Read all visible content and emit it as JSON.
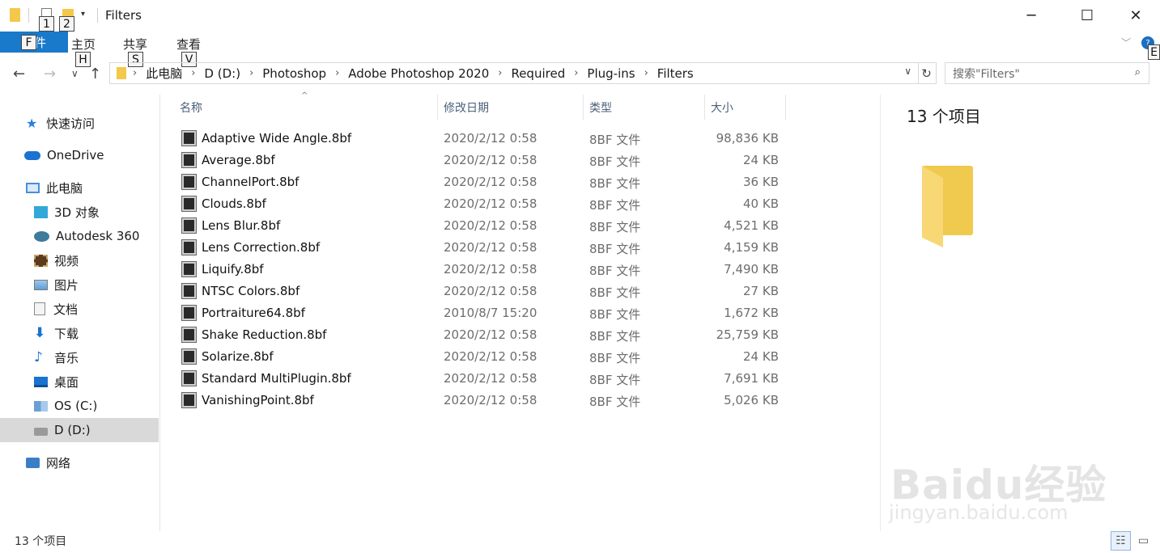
{
  "window": {
    "title": "Filters",
    "minimize": "─",
    "maximize": "☐",
    "close": "✕"
  },
  "keytips": {
    "qa1": "1",
    "qa2": "2",
    "file": "F",
    "home": "H",
    "share": "S",
    "view": "V",
    "help": "E"
  },
  "ribbon": {
    "file_label": "文件",
    "tabs": [
      "主页",
      "共享",
      "查看"
    ],
    "collapse": "﹀",
    "help": "?"
  },
  "nav_buttons": {
    "back": "←",
    "forward": "→",
    "recent": "∨",
    "up": "↑"
  },
  "address": {
    "crumbs": [
      "此电脑",
      "D (D:)",
      "Photoshop",
      "Adobe Photoshop 2020",
      "Required",
      "Plug-ins",
      "Filters"
    ],
    "separator": "›",
    "dropdown": "∨",
    "refresh": "↻"
  },
  "search": {
    "placeholder": "搜索\"Filters\"",
    "icon": "⌕"
  },
  "sidebar": {
    "items": [
      {
        "label": "快速访问",
        "icon": "star-icon",
        "color": "#2b7de1"
      },
      {
        "label": "OneDrive",
        "icon": "cloud-icon",
        "color": "#1a73d1"
      },
      {
        "label": "此电脑",
        "icon": "computer-icon",
        "color": "#4a8fd6"
      },
      {
        "label": "3D 对象",
        "icon": "cube-icon",
        "color": "#31a8d8"
      },
      {
        "label": "Autodesk 360",
        "icon": "autodesk-icon",
        "color": "#3c7b9c"
      },
      {
        "label": "视频",
        "icon": "film-icon",
        "color": "#5a3c1c"
      },
      {
        "label": "图片",
        "icon": "picture-icon",
        "color": "#4a8fd6"
      },
      {
        "label": "文档",
        "icon": "document-icon",
        "color": "#8a8a8a"
      },
      {
        "label": "下载",
        "icon": "download-icon",
        "color": "#1a73d1"
      },
      {
        "label": "音乐",
        "icon": "music-icon",
        "color": "#1a73d1"
      },
      {
        "label": "桌面",
        "icon": "desktop-icon",
        "color": "#1a73d1"
      },
      {
        "label": "OS (C:)",
        "icon": "windows-drive-icon",
        "color": "#6a9fd6"
      },
      {
        "label": "D (D:)",
        "icon": "drive-icon",
        "color": "#888888"
      },
      {
        "label": "网络",
        "icon": "network-icon",
        "color": "#3a7fc6"
      }
    ]
  },
  "columns": {
    "name": "名称",
    "date": "修改日期",
    "type": "类型",
    "size": "大小",
    "sort": "^"
  },
  "files": [
    {
      "name": "Adaptive Wide Angle.8bf",
      "date": "2020/2/12 0:58",
      "type": "8BF 文件",
      "size": "98,836 KB"
    },
    {
      "name": "Average.8bf",
      "date": "2020/2/12 0:58",
      "type": "8BF 文件",
      "size": "24 KB"
    },
    {
      "name": "ChannelPort.8bf",
      "date": "2020/2/12 0:58",
      "type": "8BF 文件",
      "size": "36 KB"
    },
    {
      "name": "Clouds.8bf",
      "date": "2020/2/12 0:58",
      "type": "8BF 文件",
      "size": "40 KB"
    },
    {
      "name": "Lens Blur.8bf",
      "date": "2020/2/12 0:58",
      "type": "8BF 文件",
      "size": "4,521 KB"
    },
    {
      "name": "Lens Correction.8bf",
      "date": "2020/2/12 0:58",
      "type": "8BF 文件",
      "size": "4,159 KB"
    },
    {
      "name": "Liquify.8bf",
      "date": "2020/2/12 0:58",
      "type": "8BF 文件",
      "size": "7,490 KB"
    },
    {
      "name": "NTSC Colors.8bf",
      "date": "2020/2/12 0:58",
      "type": "8BF 文件",
      "size": "27 KB"
    },
    {
      "name": "Portraiture64.8bf",
      "date": "2010/8/7 15:20",
      "type": "8BF 文件",
      "size": "1,672 KB"
    },
    {
      "name": "Shake Reduction.8bf",
      "date": "2020/2/12 0:58",
      "type": "8BF 文件",
      "size": "25,759 KB"
    },
    {
      "name": "Solarize.8bf",
      "date": "2020/2/12 0:58",
      "type": "8BF 文件",
      "size": "24 KB"
    },
    {
      "name": "Standard MultiPlugin.8bf",
      "date": "2020/2/12 0:58",
      "type": "8BF 文件",
      "size": "7,691 KB"
    },
    {
      "name": "VanishingPoint.8bf",
      "date": "2020/2/12 0:58",
      "type": "8BF 文件",
      "size": "5,026 KB"
    }
  ],
  "preview": {
    "count_label": "13 个项目"
  },
  "watermark": {
    "logo": "Baidu经验",
    "url": "jingyan.baidu.com"
  },
  "status": {
    "count": "13 个项目",
    "details_view": "☷",
    "preview_view": "▭"
  }
}
